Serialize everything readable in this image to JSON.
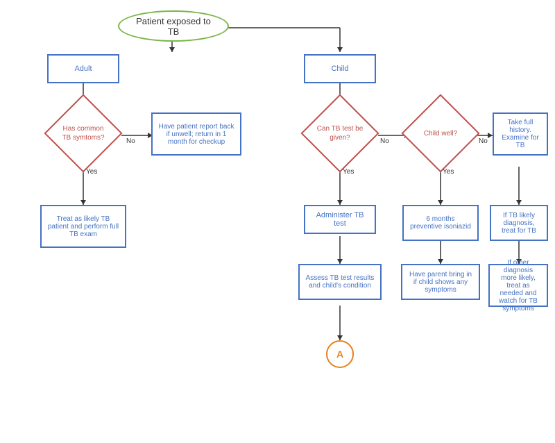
{
  "nodes": {
    "start": {
      "label": "Patient exposed to TB"
    },
    "adult": {
      "label": "Adult"
    },
    "child": {
      "label": "Child"
    },
    "diamond_adult": {
      "label": "Has common TB symtoms?"
    },
    "report_back": {
      "label": "Have patient report back if unwell; return in 1 month for checkup"
    },
    "treat_likely": {
      "label": "Treat as likely TB patient and perform full TB exam"
    },
    "diamond_tb_test": {
      "label": "Can TB test be given?"
    },
    "diamond_child_well": {
      "label": "Child well?"
    },
    "full_history": {
      "label": "Take full history. Examine for TB"
    },
    "administer": {
      "label": "Administer TB test"
    },
    "isoniazid": {
      "label": "6 months preventive isoniazid"
    },
    "tb_likely": {
      "label": "If TB likely diagnosis, treat for TB"
    },
    "assess": {
      "label": "Assess TB test results and child's condition"
    },
    "parent_bring": {
      "label": "Have parent bring in if child shows any symptoms"
    },
    "other_diagnosis": {
      "label": "If other diagnosis more likely, treat as needed and watch for TB symptoms"
    },
    "circle_a": {
      "label": "A"
    },
    "no1": {
      "label": "No"
    },
    "yes1": {
      "label": "Yes"
    },
    "no2": {
      "label": "No"
    },
    "yes2": {
      "label": "Yes"
    },
    "no3": {
      "label": "No"
    },
    "yes3": {
      "label": "Yes"
    }
  }
}
